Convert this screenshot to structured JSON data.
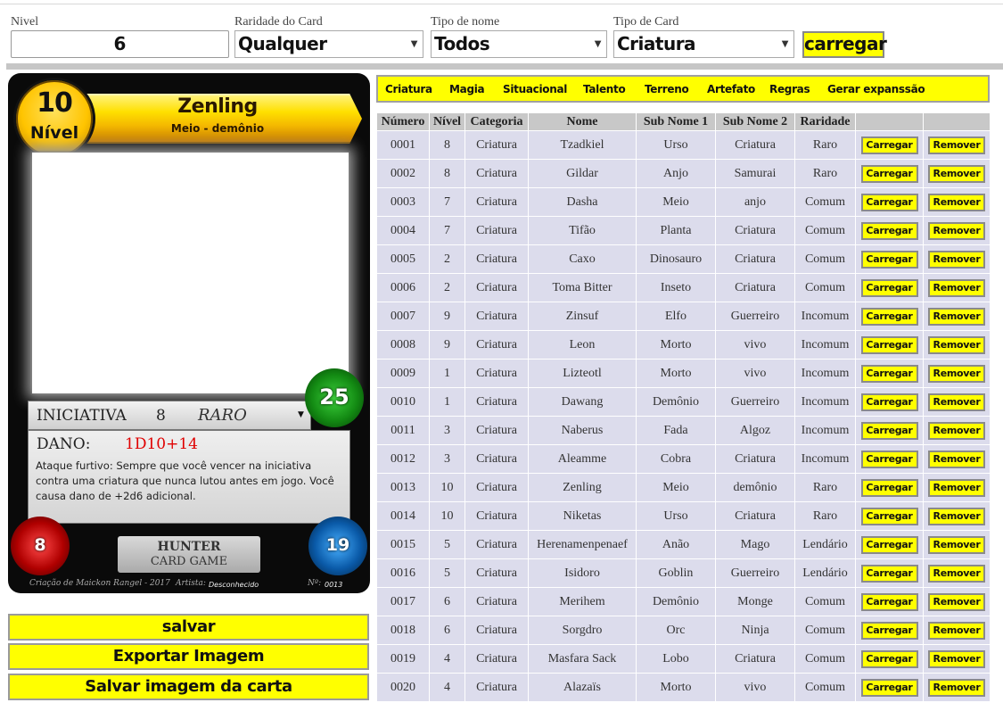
{
  "filters": {
    "nivel_label": "Nivel",
    "nivel_value": "6",
    "raridade_label": "Raridade do Card",
    "raridade_value": "Qualquer",
    "tipo_nome_label": "Tipo de nome",
    "tipo_nome_value": "Todos",
    "tipo_card_label": "Tipo de Card",
    "tipo_card_value": "Criatura",
    "carregar_label": "carregar"
  },
  "card": {
    "level_num": "10",
    "level_label": "Nível",
    "name": "Zenling",
    "subtitle": "Meio - demônio",
    "iniciativa_label": "INICIATIVA",
    "iniciativa_value": "8",
    "raridade": "RARO",
    "stat_green": "25",
    "dano_label": "DANO:",
    "dano_value": "1D10+14",
    "description": "Ataque furtivo: Sempre que você vencer na iniciativa contra uma criatura que nunca lutou antes em jogo. Você causa dano de +2d6 adicional.",
    "stat_red": "8",
    "stat_blue": "19",
    "logo_line1": "HUNTER",
    "logo_line2": "CARD GAME",
    "credit": "Criação de Maickon Rangel - 2017",
    "artist_label": "Artista:",
    "artist_value": "Desconhecido",
    "number_label": "Nº:",
    "number_value": "0013"
  },
  "actions": {
    "salvar": "salvar",
    "exportar": "Exportar Imagem",
    "salvar_imagem": "Salvar imagem da carta"
  },
  "tabs": [
    "Criatura",
    "Magia",
    "Situacional",
    "Talento",
    "Terreno",
    "Artefato",
    "Regras",
    "Gerar expanssão"
  ],
  "table": {
    "headers": [
      "Número",
      "Nível",
      "Categoria",
      "Nome",
      "Sub Nome 1",
      "Sub Nome 2",
      "Raridade",
      "",
      ""
    ],
    "load_label": "Carregar",
    "remove_label": "Remover",
    "rows": [
      [
        "0001",
        "8",
        "Criatura",
        "Tzadkiel",
        "Urso",
        "Criatura",
        "Raro"
      ],
      [
        "0002",
        "8",
        "Criatura",
        "Gildar",
        "Anjo",
        "Samurai",
        "Raro"
      ],
      [
        "0003",
        "7",
        "Criatura",
        "Dasha",
        "Meio",
        "anjo",
        "Comum"
      ],
      [
        "0004",
        "7",
        "Criatura",
        "Tifão",
        "Planta",
        "Criatura",
        "Comum"
      ],
      [
        "0005",
        "2",
        "Criatura",
        "Caxo",
        "Dinosauro",
        "Criatura",
        "Comum"
      ],
      [
        "0006",
        "2",
        "Criatura",
        "Toma Bitter",
        "Inseto",
        "Criatura",
        "Comum"
      ],
      [
        "0007",
        "9",
        "Criatura",
        "Zinsuf",
        "Elfo",
        "Guerreiro",
        "Incomum"
      ],
      [
        "0008",
        "9",
        "Criatura",
        "Leon",
        "Morto",
        "vivo",
        "Incomum"
      ],
      [
        "0009",
        "1",
        "Criatura",
        "Lizteotl",
        "Morto",
        "vivo",
        "Incomum"
      ],
      [
        "0010",
        "1",
        "Criatura",
        "Dawang",
        "Demônio",
        "Guerreiro",
        "Incomum"
      ],
      [
        "0011",
        "3",
        "Criatura",
        "Naberus",
        "Fada",
        "Algoz",
        "Incomum"
      ],
      [
        "0012",
        "3",
        "Criatura",
        "Aleamme",
        "Cobra",
        "Criatura",
        "Incomum"
      ],
      [
        "0013",
        "10",
        "Criatura",
        "Zenling",
        "Meio",
        "demônio",
        "Raro"
      ],
      [
        "0014",
        "10",
        "Criatura",
        "Niketas",
        "Urso",
        "Criatura",
        "Raro"
      ],
      [
        "0015",
        "5",
        "Criatura",
        "Herenamenpenaef",
        "Anão",
        "Mago",
        "Lendário"
      ],
      [
        "0016",
        "5",
        "Criatura",
        "Isidoro",
        "Goblin",
        "Guerreiro",
        "Lendário"
      ],
      [
        "0017",
        "6",
        "Criatura",
        "Merihem",
        "Demônio",
        "Monge",
        "Comum"
      ],
      [
        "0018",
        "6",
        "Criatura",
        "Sorgdro",
        "Orc",
        "Ninja",
        "Comum"
      ],
      [
        "0019",
        "4",
        "Criatura",
        "Masfara Sack",
        "Lobo",
        "Criatura",
        "Comum"
      ],
      [
        "0020",
        "4",
        "Criatura",
        "Alazaïs",
        "Morto",
        "vivo",
        "Comum"
      ]
    ]
  }
}
